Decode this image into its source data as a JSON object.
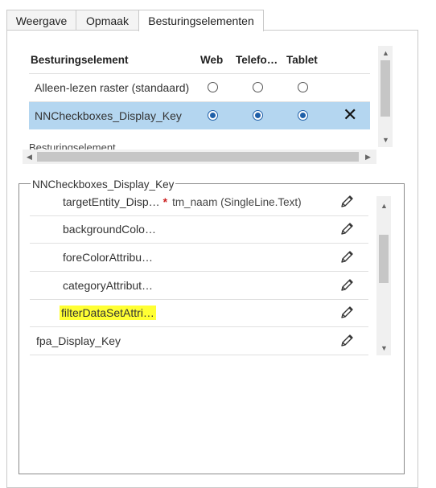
{
  "tabs": [
    {
      "label": "Weergave"
    },
    {
      "label": "Opmaak"
    },
    {
      "label": "Besturingselementen"
    }
  ],
  "controls_grid": {
    "headers": {
      "control": "Besturingselement",
      "web": "Web",
      "phone": "Telefo…",
      "tablet": "Tablet"
    },
    "rows": [
      {
        "label": "Alleen-lezen raster (standaard)",
        "web": false,
        "phone": false,
        "tablet": false,
        "selected": false
      },
      {
        "label": "NNCheckboxes_Display_Key",
        "web": true,
        "phone": true,
        "tablet": true,
        "selected": true
      }
    ],
    "partial_row_label": "Besturingselement"
  },
  "properties": {
    "group_title": "NNCheckboxes_Display_Key",
    "rows": [
      {
        "label": "targetEntity_Disp…",
        "required": "*",
        "value": "tm_naam (SingleLine.Text)",
        "highlight": false
      },
      {
        "label": "backgroundColo…",
        "highlight": false
      },
      {
        "label": "foreColorAttribu…",
        "highlight": false
      },
      {
        "label": "categoryAttribut…",
        "highlight": false
      },
      {
        "label": "filterDataSetAttri…",
        "highlight": true
      },
      {
        "label": "fpa_Display_Key",
        "highlight": false
      }
    ]
  },
  "colors": {
    "selected_row": "#b4d6f0",
    "highlight": "#ffff33",
    "radio_on": "#1f5fa8"
  },
  "icons": {
    "remove": "close-icon",
    "edit": "pencil-icon"
  }
}
